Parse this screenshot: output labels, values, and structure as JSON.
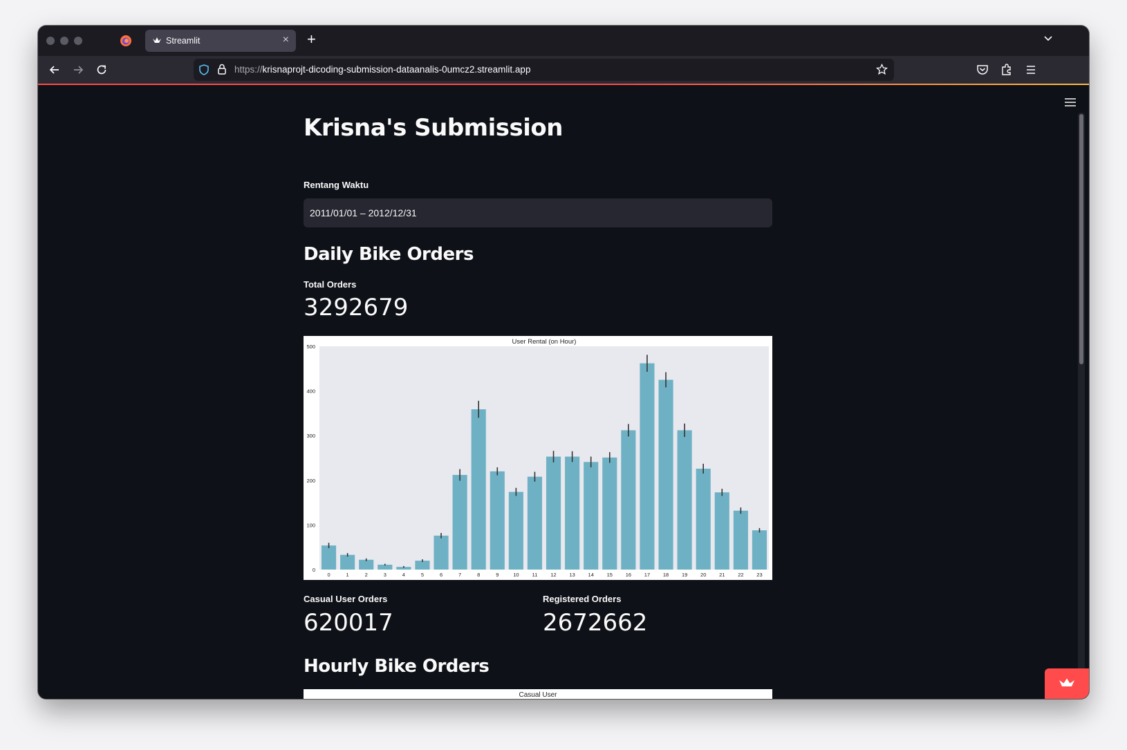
{
  "browser": {
    "tab_title": "Streamlit",
    "url_scheme": "https://",
    "url_host": "krisnaprojt-dicoding-submission-dataanalis-0umcz2.streamlit.app"
  },
  "app": {
    "title": "Krisna's Submission",
    "date_label": "Rentang Waktu",
    "date_value": "2011/01/01 – 2012/12/31",
    "daily_header": "Daily Bike Orders",
    "total_label": "Total Orders",
    "total_value": "3292679",
    "casual_label": "Casual User Orders",
    "casual_value": "620017",
    "registered_label": "Registered Orders",
    "registered_value": "2672662",
    "hourly_header": "Hourly Bike Orders",
    "second_chart_title": "Casual User"
  },
  "colors": {
    "accent": "#ff4b4b",
    "bar": "#6fb1c4",
    "plot_bg": "#e8e8ef",
    "app_bg": "#0e1117"
  },
  "chart_data": {
    "type": "bar",
    "title": "User Rental (on Hour)",
    "xlabel": "",
    "ylabel": "",
    "categories": [
      "0",
      "1",
      "2",
      "3",
      "4",
      "5",
      "6",
      "7",
      "8",
      "9",
      "10",
      "11",
      "12",
      "13",
      "14",
      "15",
      "16",
      "17",
      "18",
      "19",
      "20",
      "21",
      "22",
      "23"
    ],
    "values": [
      54,
      33,
      22,
      11,
      6,
      20,
      76,
      212,
      359,
      220,
      174,
      208,
      253,
      253,
      241,
      251,
      312,
      462,
      425,
      312,
      226,
      173,
      132,
      88
    ],
    "errors": [
      6,
      4,
      3,
      2,
      2,
      3,
      6,
      13,
      19,
      9,
      9,
      11,
      13,
      12,
      12,
      12,
      14,
      19,
      17,
      15,
      11,
      8,
      7,
      5
    ],
    "yticks": [
      0,
      100,
      200,
      300,
      400,
      500
    ],
    "ylim": [
      0,
      500
    ],
    "grid": false
  }
}
